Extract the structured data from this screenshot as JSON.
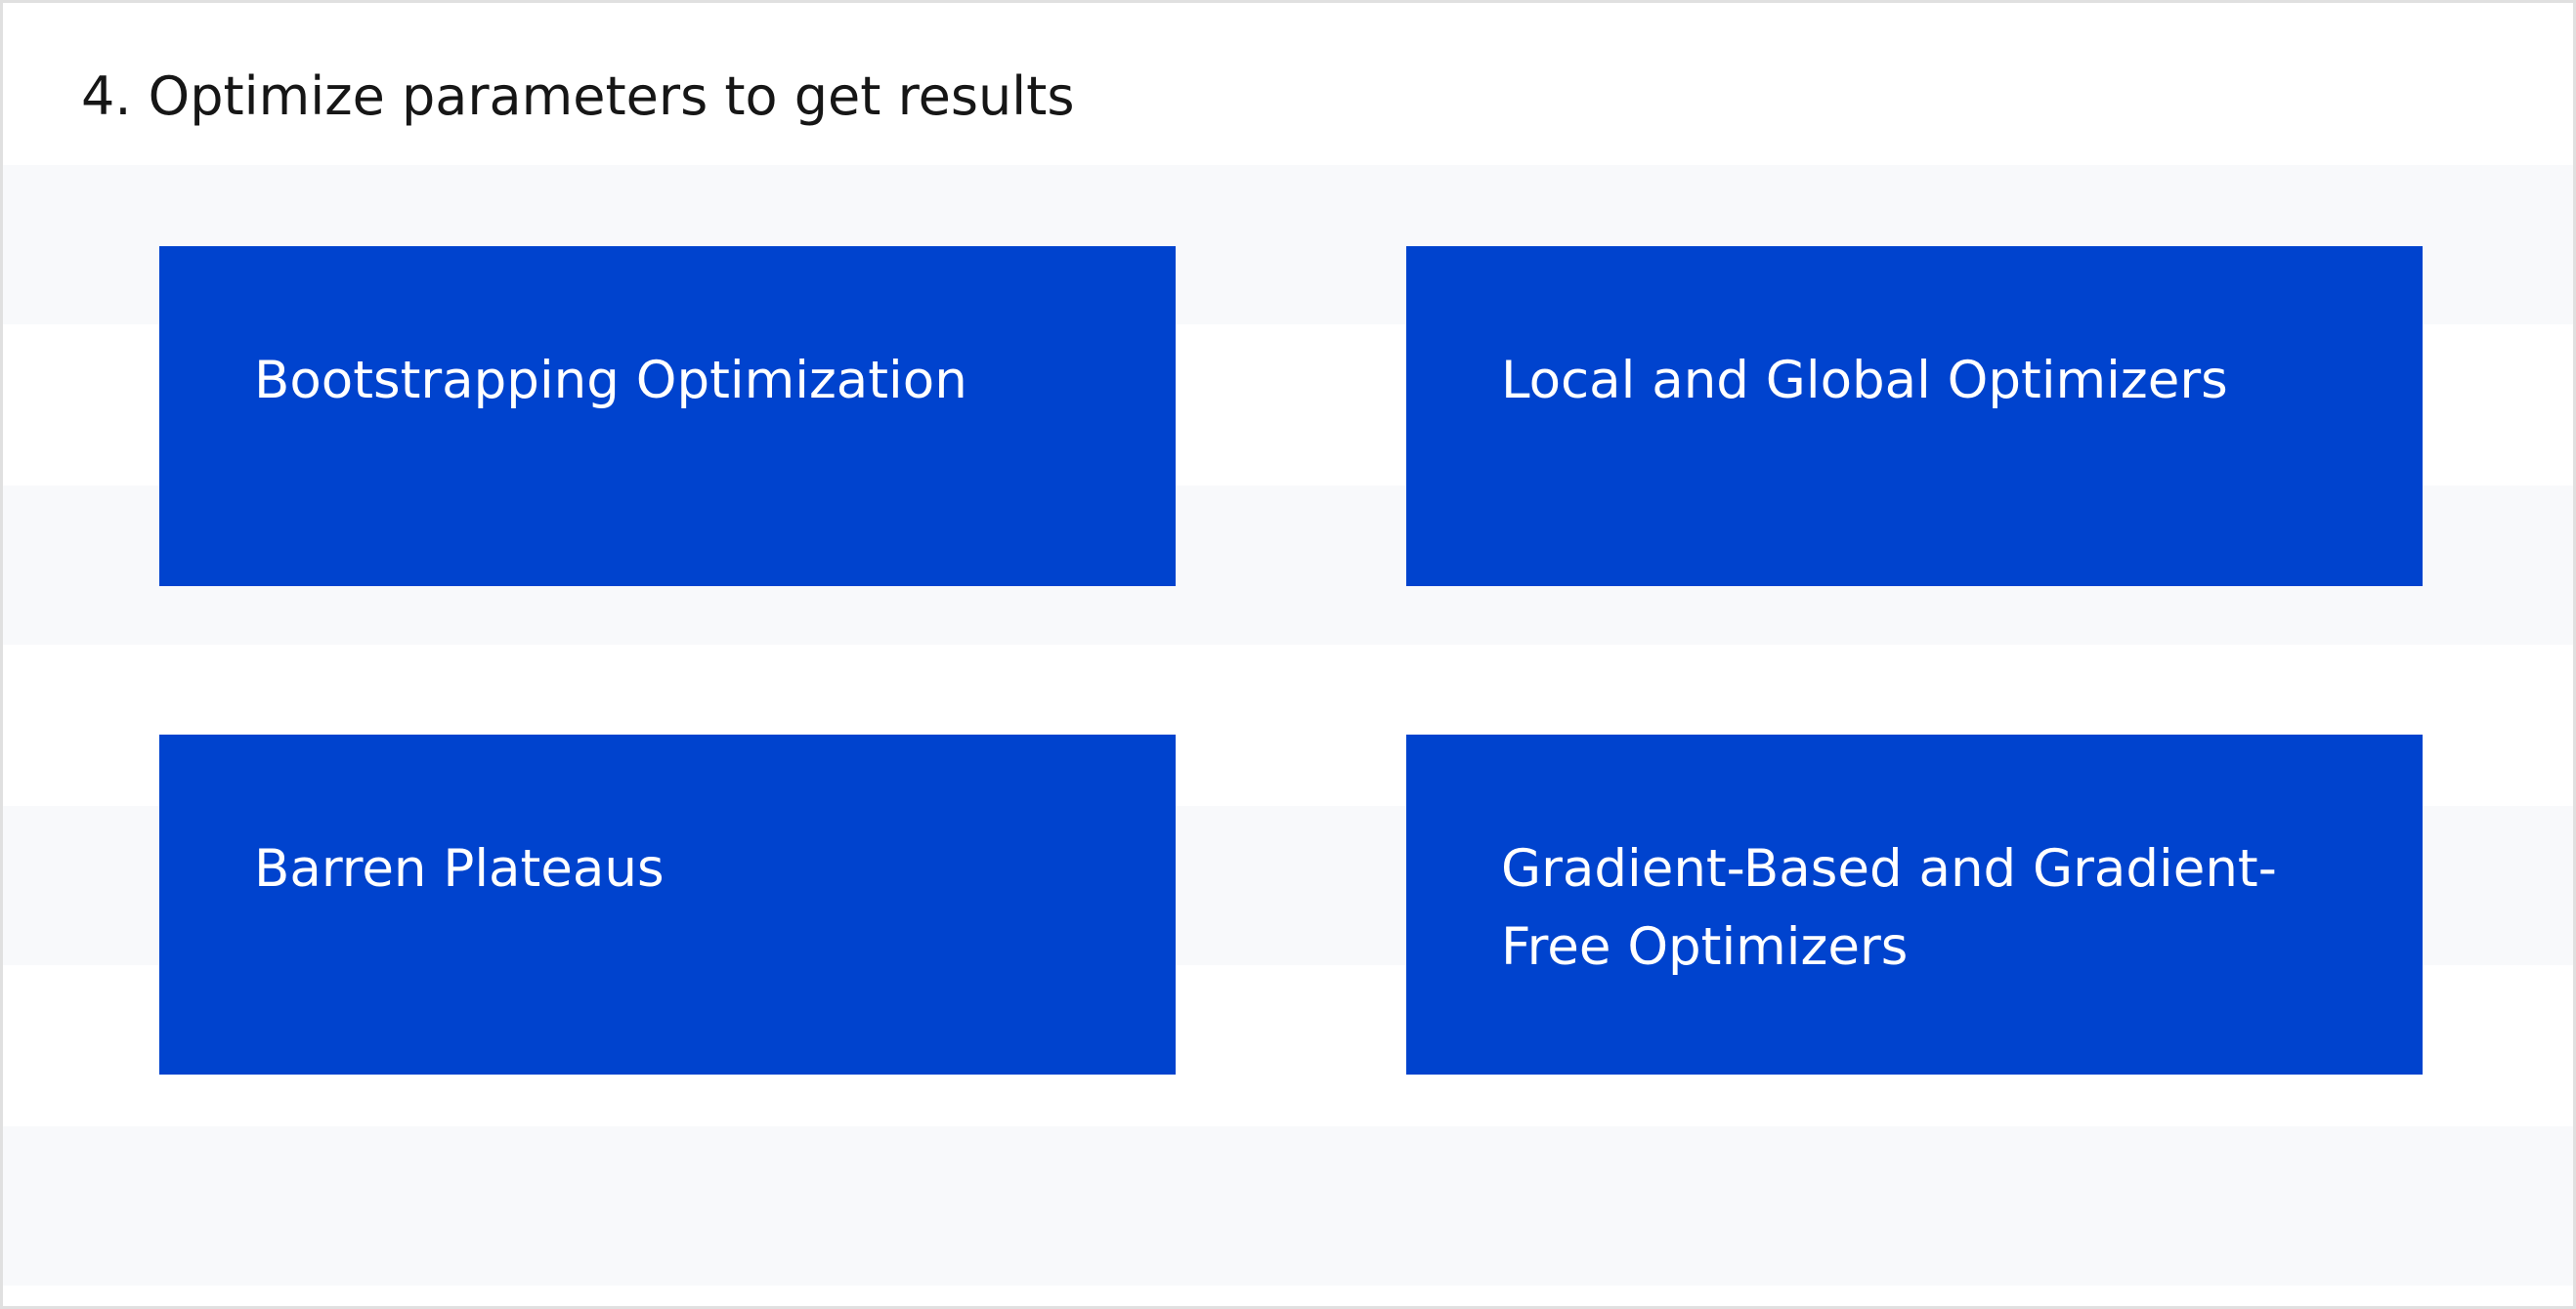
{
  "header": {
    "title": "4. Optimize parameters to get results"
  },
  "tiles": [
    {
      "label": "Bootstrapping Optimization"
    },
    {
      "label": "Local and Global Optimizers"
    },
    {
      "label": "Barren Plateaus"
    },
    {
      "label": "Gradient-Based and Gradient-Free Optimizers"
    }
  ],
  "colors": {
    "tile_background": "#0043ce",
    "tile_text": "#ffffff",
    "stripe_background": "#f8f9fb",
    "page_background": "#ffffff",
    "title_text": "#161616"
  }
}
